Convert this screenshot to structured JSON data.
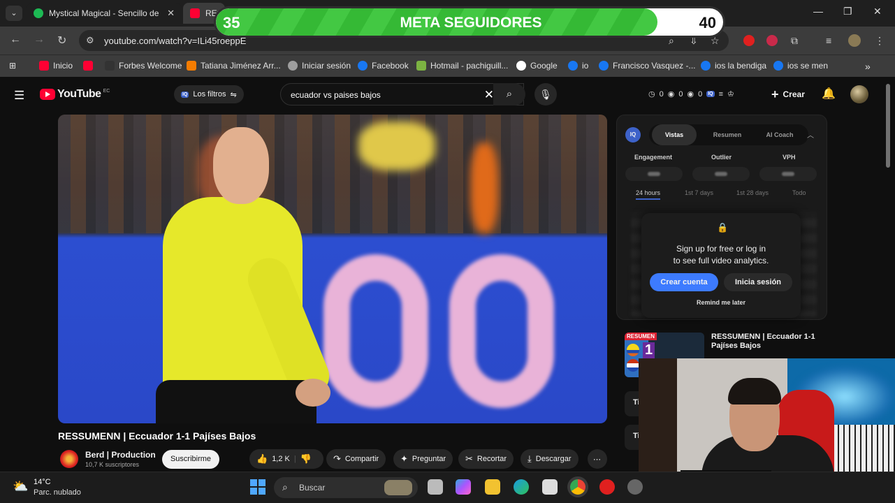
{
  "browser": {
    "tabs": [
      {
        "title": "Mystical Magical - Sencillo de S",
        "favicon_color": "#1db954"
      },
      {
        "title": "RES",
        "favicon_color": "#ff0033"
      }
    ],
    "url": "youtube.com/watch?v=ILi45roeppE",
    "bookmarks": [
      {
        "label": "Inicio",
        "color": "#ff0033"
      },
      {
        "label": "",
        "color": "#ff0033"
      },
      {
        "label": "Forbes Welcome",
        "color": "#333333"
      },
      {
        "label": "Tatiana Jiménez Arr...",
        "color": "#f57c00"
      },
      {
        "label": "Iniciar sesión",
        "color": "#9e9e9e"
      },
      {
        "label": "Facebook",
        "color": "#1877f2"
      },
      {
        "label": "Hotmail - pachiguill...",
        "color": "#7cb342"
      },
      {
        "label": "Google",
        "color": "#ffffff"
      },
      {
        "label": "io",
        "color": "#1877f2"
      },
      {
        "label": "Francisco Vasquez -...",
        "color": "#1877f2"
      },
      {
        "label": "ios la bendiga",
        "color": "#1877f2"
      },
      {
        "label": "ios se men",
        "color": "#1877f2"
      }
    ]
  },
  "overlay": {
    "title": "META SEGUIDORES",
    "current": "35",
    "goal": "40",
    "progress_fraction": 0.87,
    "accent": "#3cbf3c"
  },
  "youtube": {
    "logo_text": "YouTube",
    "country_code": "EC",
    "filters_label": "Los filtros",
    "iq_badge": "IQ",
    "search_query": "ecuador vs paises bajos",
    "stats": [
      "0",
      "0",
      "0"
    ],
    "create_label": "Crear"
  },
  "video": {
    "title": "RESSUMENN | Eccuador 1-1 Pajíses Bajos",
    "channel": "Berd | Production",
    "subscribers": "10,7 K suscriptores",
    "subscribe_label": "Suscribirme",
    "likes": "1,2 K",
    "actions": {
      "share": "Compartir",
      "ask": "Preguntar",
      "clip": "Recortar",
      "download": "Descargar"
    }
  },
  "vidiq": {
    "logo": "IQ",
    "tabs": [
      "Vistas",
      "Resumen",
      "AI Coach"
    ],
    "active_tab": "Vistas",
    "metrics": [
      "Engagement",
      "Outlier",
      "VPH"
    ],
    "ranges": [
      "24 hours",
      "1st 7 days",
      "1st 28 days",
      "Todo"
    ],
    "signup": {
      "line1": "Sign up for free or log in",
      "line2": "to see full video analytics.",
      "create_account": "Crear cuenta",
      "login": "Inicia sesión",
      "remind": "Remind me later"
    }
  },
  "recommended": {
    "badge": "RESUMEN",
    "score": "1",
    "title": "RESSUMENN | Eccuador 1-1 Pajíses Bajos",
    "cut_items": [
      "Ti",
      "Ti"
    ]
  },
  "taskbar": {
    "temperature": "14°C",
    "weather": "Parc. nublado",
    "search_placeholder": "Buscar"
  }
}
